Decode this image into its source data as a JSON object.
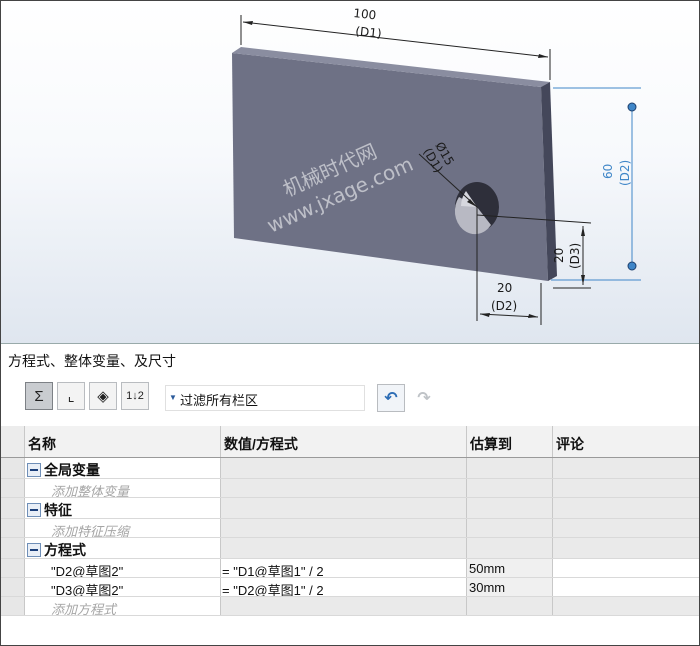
{
  "viewport": {
    "dims": {
      "width_value": "100",
      "width_name": "(D1)",
      "height_value": "60",
      "height_name": "(D2)",
      "diameter_value": "Ø15",
      "diameter_name": "(D1)",
      "hole_x_value": "20",
      "hole_x_name": "(D2)",
      "hole_y_value": "20",
      "hole_y_name": "(D3)"
    },
    "watermark": {
      "line1": "机械时代网",
      "line2": "www.jxage.com"
    }
  },
  "dialog": {
    "title": "方程式、整体变量、及尺寸",
    "filter_text": "过滤所有栏区",
    "toolbar_icons": [
      "equation-view-icon",
      "sketch-equation-view-icon",
      "dimension-view-icon",
      "ordered-view-icon"
    ],
    "columns": [
      "名称",
      "数值/方程式",
      "估算到",
      "评论"
    ],
    "sections": {
      "global": {
        "label": "全局变量",
        "add_label": "添加整体变量"
      },
      "features": {
        "label": "特征",
        "add_label": "添加特征压缩"
      },
      "equations": {
        "label": "方程式",
        "add_label": "添加方程式",
        "rows": [
          {
            "name": "\"D2@草图2\"",
            "value": "= \"D1@草图1\" / 2",
            "evaluates": "50mm",
            "comment": ""
          },
          {
            "name": "\"D3@草图2\"",
            "value": "= \"D2@草图1\" / 2",
            "evaluates": "30mm",
            "comment": ""
          }
        ]
      }
    }
  },
  "colors": {
    "plate_face": "#6e7185",
    "plate_top": "#8a8da0",
    "plate_side": "#44475a",
    "dimension_blue": "#3f86c8",
    "grid_fill": "#eaeaea"
  }
}
